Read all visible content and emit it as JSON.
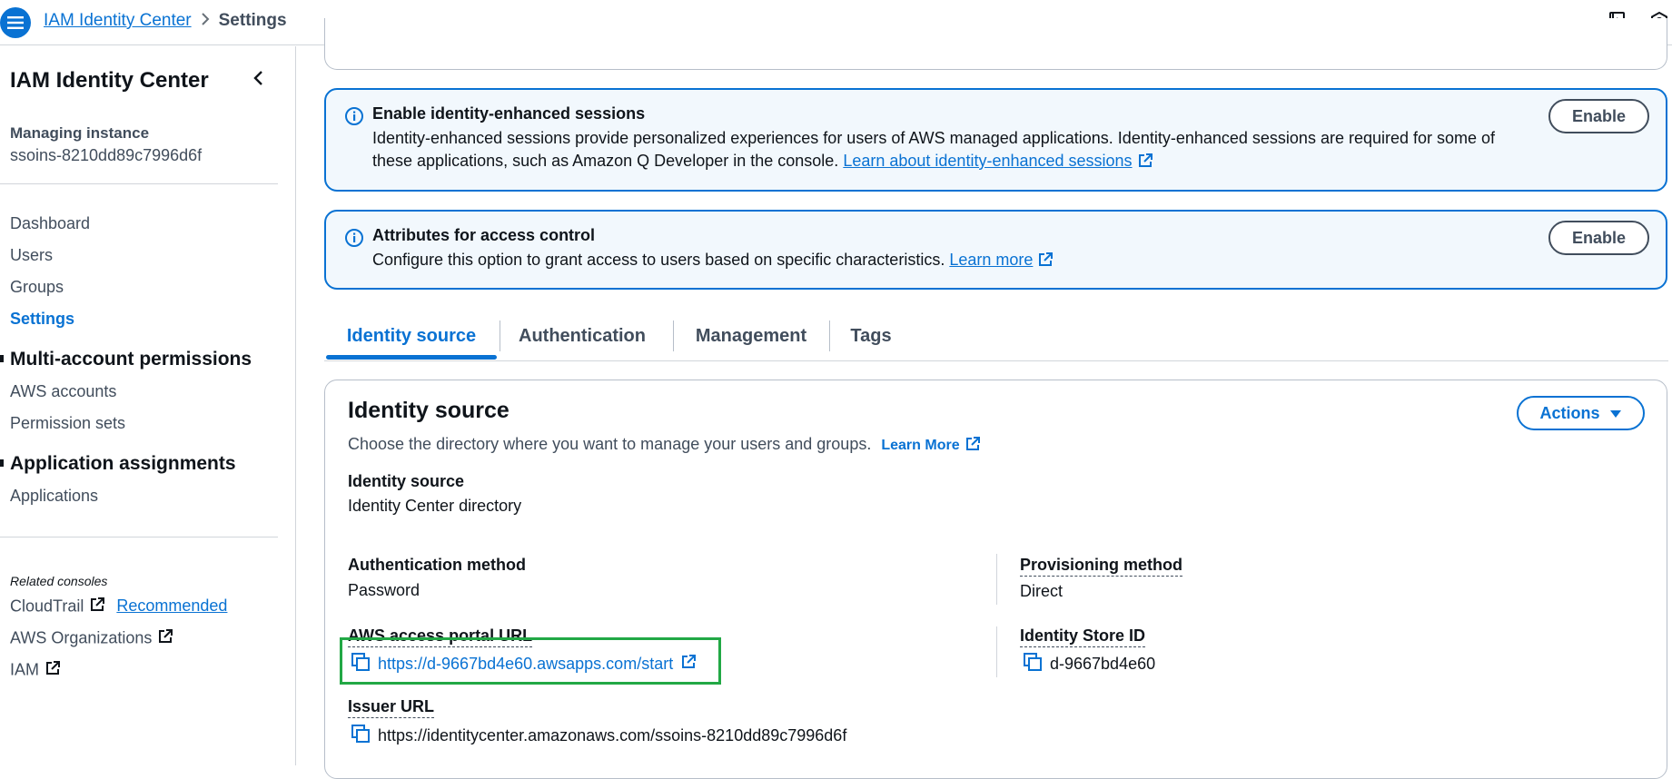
{
  "topbar": {
    "breadcrumb": {
      "parent": "IAM Identity Center",
      "current": "Settings"
    },
    "icons": [
      "menu-icon",
      "notebook-icon",
      "settings-hex-icon"
    ]
  },
  "sidebar": {
    "title": "IAM Identity Center",
    "managing_label": "Managing instance",
    "managing_value": "ssoins-8210dd89c7996d6f",
    "items": [
      {
        "label": "Dashboard"
      },
      {
        "label": "Users"
      },
      {
        "label": "Groups"
      },
      {
        "label": "Settings",
        "active": true
      }
    ],
    "sections": [
      {
        "title": "Multi-account permissions",
        "items": [
          "AWS accounts",
          "Permission sets"
        ]
      },
      {
        "title": "Application assignments",
        "items": [
          "Applications"
        ]
      }
    ],
    "related_label": "Related consoles",
    "related": [
      {
        "label": "CloudTrail",
        "badge": "Recommended"
      },
      {
        "label": "AWS Organizations"
      },
      {
        "label": "IAM"
      }
    ]
  },
  "alerts": [
    {
      "title": "Enable identity-enhanced sessions",
      "body": "Identity-enhanced sessions provide personalized experiences for users of AWS managed applications. Identity-enhanced sessions are required for some of these applications, such as Amazon Q Developer in the console.",
      "link": "Learn about identity-enhanced sessions",
      "button": "Enable"
    },
    {
      "title": "Attributes for access control",
      "body": "Configure this option to grant access to users based on specific characteristics.",
      "link": "Learn more",
      "button": "Enable"
    }
  ],
  "tabs": [
    "Identity source",
    "Authentication",
    "Management",
    "Tags"
  ],
  "active_tab": "Identity source",
  "panel": {
    "title": "Identity source",
    "description": "Choose the directory where you want to manage your users and groups.",
    "learn_more": "Learn More",
    "actions_label": "Actions",
    "identity_source_label": "Identity source",
    "identity_source_value": "Identity Center directory",
    "auth_method_label": "Authentication method",
    "auth_method_value": "Password",
    "provisioning_label": "Provisioning method",
    "provisioning_value": "Direct",
    "portal_url_label": "AWS access portal URL",
    "portal_url_value": "https://d-9667bd4e60.awsapps.com/start",
    "store_id_label": "Identity Store ID",
    "store_id_value": "d-9667bd4e60",
    "issuer_url_label": "Issuer URL",
    "issuer_url_value": "https://identitycenter.amazonaws.com/ssoins-8210dd89c7996d6f"
  },
  "colors": {
    "accent": "#0972d3",
    "highlight": "#22a845",
    "alert_bg": "#f2f8fd"
  }
}
